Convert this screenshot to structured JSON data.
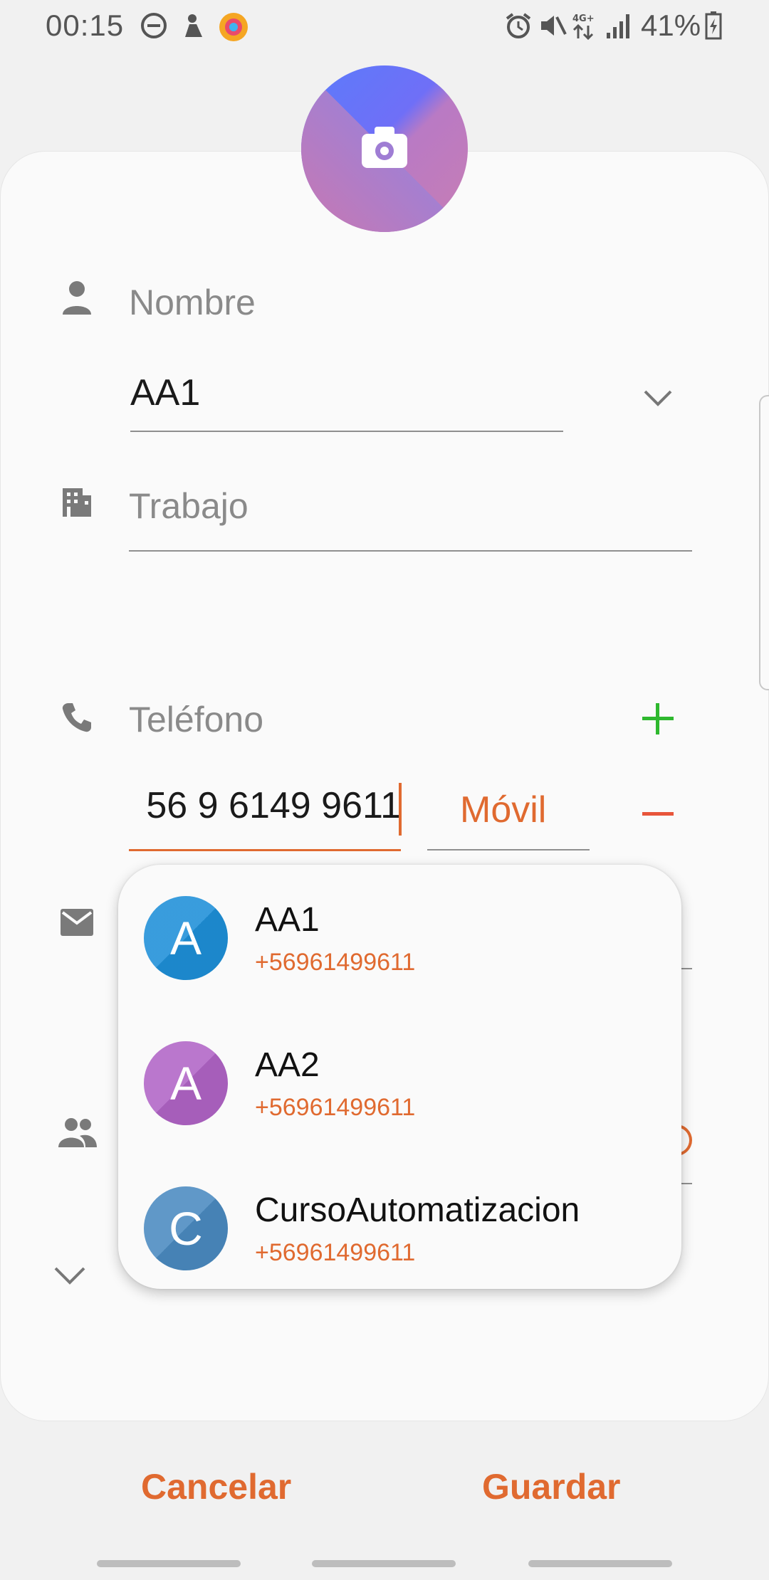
{
  "status_bar": {
    "time": "00:15",
    "battery": "41%",
    "icons": [
      "do-not-disturb-icon",
      "notification-icon",
      "app-icon",
      "alarm-icon",
      "mute-icon",
      "4g-icon",
      "signal-icon",
      "battery-icon"
    ]
  },
  "form": {
    "name_label": "Nombre",
    "name_value": "AA1",
    "work_label": "Trabajo",
    "phone_label": "Teléfono",
    "phone_value": "56 9 6149 9611",
    "phone_type": "Móvil"
  },
  "suggestions": [
    {
      "initial": "A",
      "name": "AA1",
      "phone": "+56961499611",
      "color": "#1e8fd8"
    },
    {
      "initial": "A",
      "name": "AA2",
      "phone": "+56961499611",
      "color": "#b064c6"
    },
    {
      "initial": "C",
      "name": "CursoAutomatizacion",
      "phone": "+56961499611",
      "color": "#4a8ac0"
    }
  ],
  "actions": {
    "cancel": "Cancelar",
    "save": "Guardar"
  },
  "colors": {
    "accent": "#e06a30",
    "add": "#2eb82e",
    "remove": "#e8553a"
  }
}
